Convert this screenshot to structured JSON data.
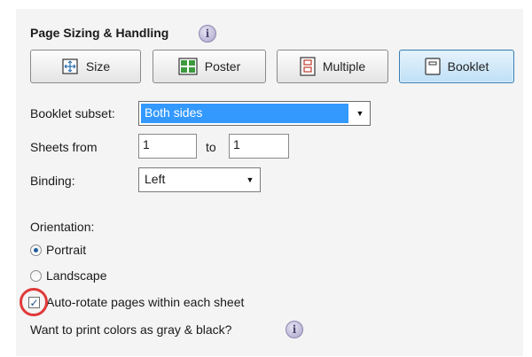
{
  "section": {
    "title": "Page Sizing & Handling",
    "info_icon": "info-icon"
  },
  "tabs": [
    {
      "label": "Size",
      "icon": "size-icon",
      "active": false
    },
    {
      "label": "Poster",
      "icon": "poster-icon",
      "active": false
    },
    {
      "label": "Multiple",
      "icon": "multiple-icon",
      "active": false
    },
    {
      "label": "Booklet",
      "icon": "booklet-icon",
      "active": true
    }
  ],
  "booklet_subset": {
    "label": "Booklet subset:",
    "value": "Both sides"
  },
  "sheets": {
    "label": "Sheets from",
    "from": "1",
    "to_label": "to",
    "to": "1"
  },
  "binding": {
    "label": "Binding:",
    "value": "Left"
  },
  "orientation": {
    "label": "Orientation:",
    "portrait": {
      "label": "Portrait",
      "checked": true
    },
    "landscape": {
      "label": "Landscape",
      "checked": false
    }
  },
  "auto_rotate": {
    "label": "Auto-rotate pages within each sheet",
    "checked": true
  },
  "gray_print": {
    "label": "Want to print colors as gray & black?",
    "info_icon": "info-icon"
  },
  "colors": {
    "accent": "#3399ff",
    "active_tab": "#bfe0f6",
    "highlight_ring": "#e03a3a"
  }
}
